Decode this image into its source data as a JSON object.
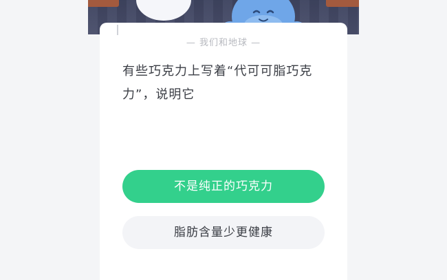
{
  "section_label": "— 我们和地球 —",
  "question": "有些巧克力上写着“代可可脂巧克力”，说明它",
  "options": [
    {
      "label": "不是纯正的巧克力",
      "state": "selected-correct"
    },
    {
      "label": "脂肪含量少更健康",
      "state": "default"
    }
  ],
  "colors": {
    "correct": "#33d08c",
    "option_bg": "#f3f4f7",
    "banner": "#3e4460",
    "mascot": "#6fa6e8"
  },
  "icons": {
    "mascot": "blue-whale-mascot-icon"
  }
}
